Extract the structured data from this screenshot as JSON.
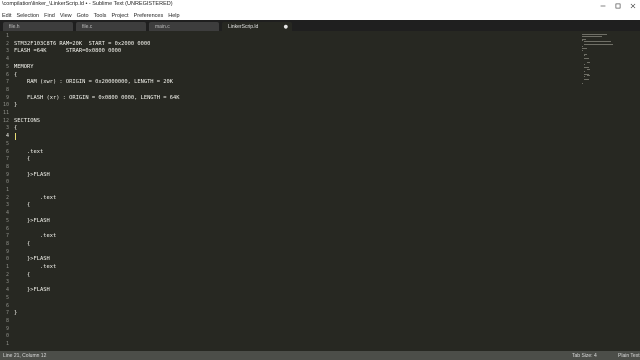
{
  "window": {
    "title": "\\compilation\\linker_\\LinkerScrip.ld • - Sublime Text (UNREGISTERED)"
  },
  "menu": [
    "Edit",
    "Selection",
    "Find",
    "View",
    "Goto",
    "Tools",
    "Project",
    "Preferences",
    "Help"
  ],
  "tabs": [
    {
      "label": "file.h",
      "active": false
    },
    {
      "label": "file.c",
      "active": false
    },
    {
      "label": "main.c",
      "active": false
    },
    {
      "label": "LinkerScrip.ld",
      "active": true
    }
  ],
  "editor": {
    "current_line": 13,
    "lines": [
      {
        "n": "1",
        "text": ""
      },
      {
        "n": "2",
        "text": "STM32F103C8T6 RAM=20K  START = 0x2000 0000"
      },
      {
        "n": "3",
        "text": "FLASH =64K      STRAR=0x0800 0000"
      },
      {
        "n": "4",
        "text": ""
      },
      {
        "n": "5",
        "text": "MEMORY"
      },
      {
        "n": "6",
        "text": "{"
      },
      {
        "n": "7",
        "text": "    RAM (xwr) : ORIGIN = 0x20000000, LENGTH = 20K"
      },
      {
        "n": "8",
        "text": ""
      },
      {
        "n": "9",
        "text": "    FLASH (xr) : ORIGIN = 0x0800 0000, LENGTH = 64K"
      },
      {
        "n": "10",
        "text": "}"
      },
      {
        "n": "11",
        "text": ""
      },
      {
        "n": "12",
        "text": "SECTIONS"
      },
      {
        "n": "3",
        "text": "{"
      },
      {
        "n": "4",
        "text": ""
      },
      {
        "n": "5",
        "text": ""
      },
      {
        "n": "6",
        "text": "    .text"
      },
      {
        "n": "7",
        "text": "    {"
      },
      {
        "n": "8",
        "text": ""
      },
      {
        "n": "9",
        "text": "    }>FLASH"
      },
      {
        "n": "0",
        "text": ""
      },
      {
        "n": "1",
        "text": ""
      },
      {
        "n": "2",
        "text": "        .text"
      },
      {
        "n": "3",
        "text": "    {"
      },
      {
        "n": "4",
        "text": ""
      },
      {
        "n": "5",
        "text": "    }>FLASH"
      },
      {
        "n": "6",
        "text": ""
      },
      {
        "n": "7",
        "text": "        .text"
      },
      {
        "n": "8",
        "text": "    {"
      },
      {
        "n": "9",
        "text": ""
      },
      {
        "n": "0",
        "text": "    }>FLASH"
      },
      {
        "n": "1",
        "text": "        .text"
      },
      {
        "n": "2",
        "text": "    {"
      },
      {
        "n": "3",
        "text": ""
      },
      {
        "n": "4",
        "text": "    }>FLASH"
      },
      {
        "n": "5",
        "text": ""
      },
      {
        "n": "6",
        "text": ""
      },
      {
        "n": "7",
        "text": "}"
      },
      {
        "n": "8",
        "text": ""
      },
      {
        "n": "9",
        "text": ""
      },
      {
        "n": "0",
        "text": ""
      },
      {
        "n": "1",
        "text": ""
      }
    ]
  },
  "status": {
    "position": "Line 21, Column 12",
    "tab_size": "Tab Size: 4",
    "syntax": "Plain Text"
  },
  "colors": {
    "editor_bg": "#272822",
    "foreground": "#f8f8f2",
    "gutter_text": "#8f908a",
    "caret": "#e6db74",
    "tabbar_bg": "#1f1f1f",
    "statusbar_bg": "#4c4e49"
  },
  "icons": [
    "minimize-icon",
    "maximize-icon",
    "close-icon",
    "tab-close-icon"
  ]
}
